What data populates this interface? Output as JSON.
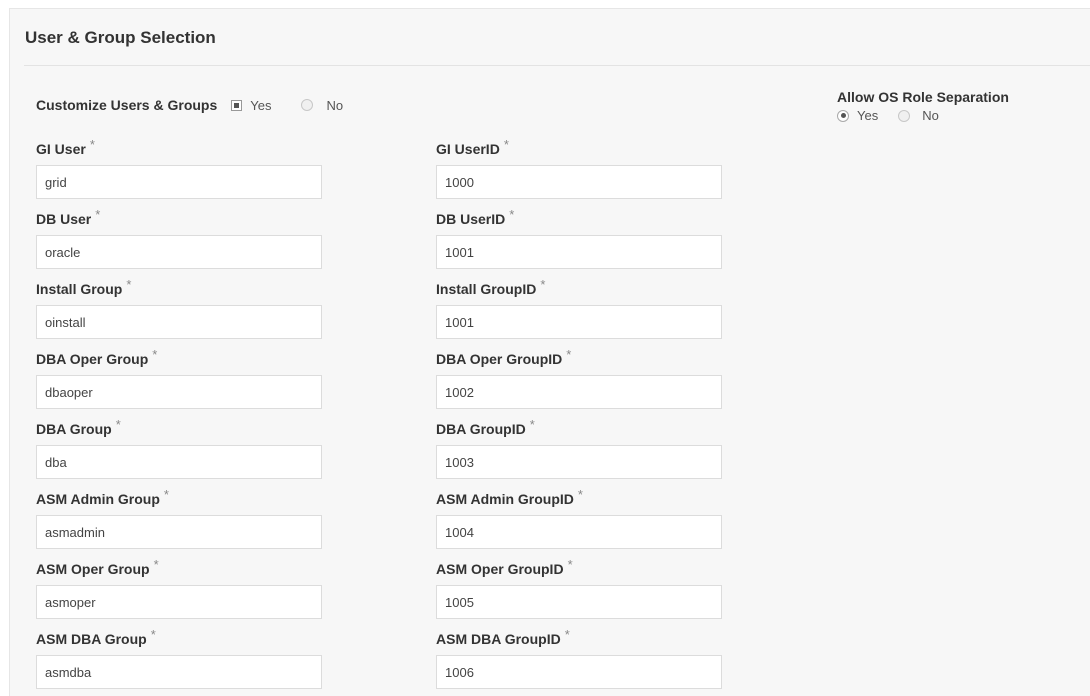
{
  "panel": {
    "title": "User & Group Selection"
  },
  "customize": {
    "label": "Customize Users & Groups",
    "yes_label": "Yes",
    "no_label": "No",
    "selected": "Yes"
  },
  "os_role": {
    "label": "Allow OS Role Separation",
    "yes_label": "Yes",
    "no_label": "No",
    "selected": "Yes"
  },
  "required_mark": "*",
  "fields": {
    "gi_user": {
      "label": "GI User",
      "value": "grid"
    },
    "gi_userid": {
      "label": "GI UserID",
      "value": "1000"
    },
    "db_user": {
      "label": "DB User",
      "value": "oracle"
    },
    "db_userid": {
      "label": "DB UserID",
      "value": "1001"
    },
    "install_group": {
      "label": "Install Group",
      "value": "oinstall"
    },
    "install_groupid": {
      "label": "Install GroupID",
      "value": "1001"
    },
    "dba_oper_group": {
      "label": "DBA Oper Group",
      "value": "dbaoper"
    },
    "dba_oper_groupid": {
      "label": "DBA Oper GroupID",
      "value": "1002"
    },
    "dba_group": {
      "label": "DBA Group",
      "value": "dba"
    },
    "dba_groupid": {
      "label": "DBA GroupID",
      "value": "1003"
    },
    "asm_admin_group": {
      "label": "ASM Admin Group",
      "value": "asmadmin"
    },
    "asm_admin_groupid": {
      "label": "ASM Admin GroupID",
      "value": "1004"
    },
    "asm_oper_group": {
      "label": "ASM Oper Group",
      "value": "asmoper"
    },
    "asm_oper_groupid": {
      "label": "ASM Oper GroupID",
      "value": "1005"
    },
    "asm_dba_group": {
      "label": "ASM DBA Group",
      "value": "asmdba"
    },
    "asm_dba_groupid": {
      "label": "ASM DBA GroupID",
      "value": "1006"
    }
  },
  "colors": {
    "panel_bg": "#f7f7f7",
    "input_border": "#dcdcdc",
    "text": "#333333"
  }
}
